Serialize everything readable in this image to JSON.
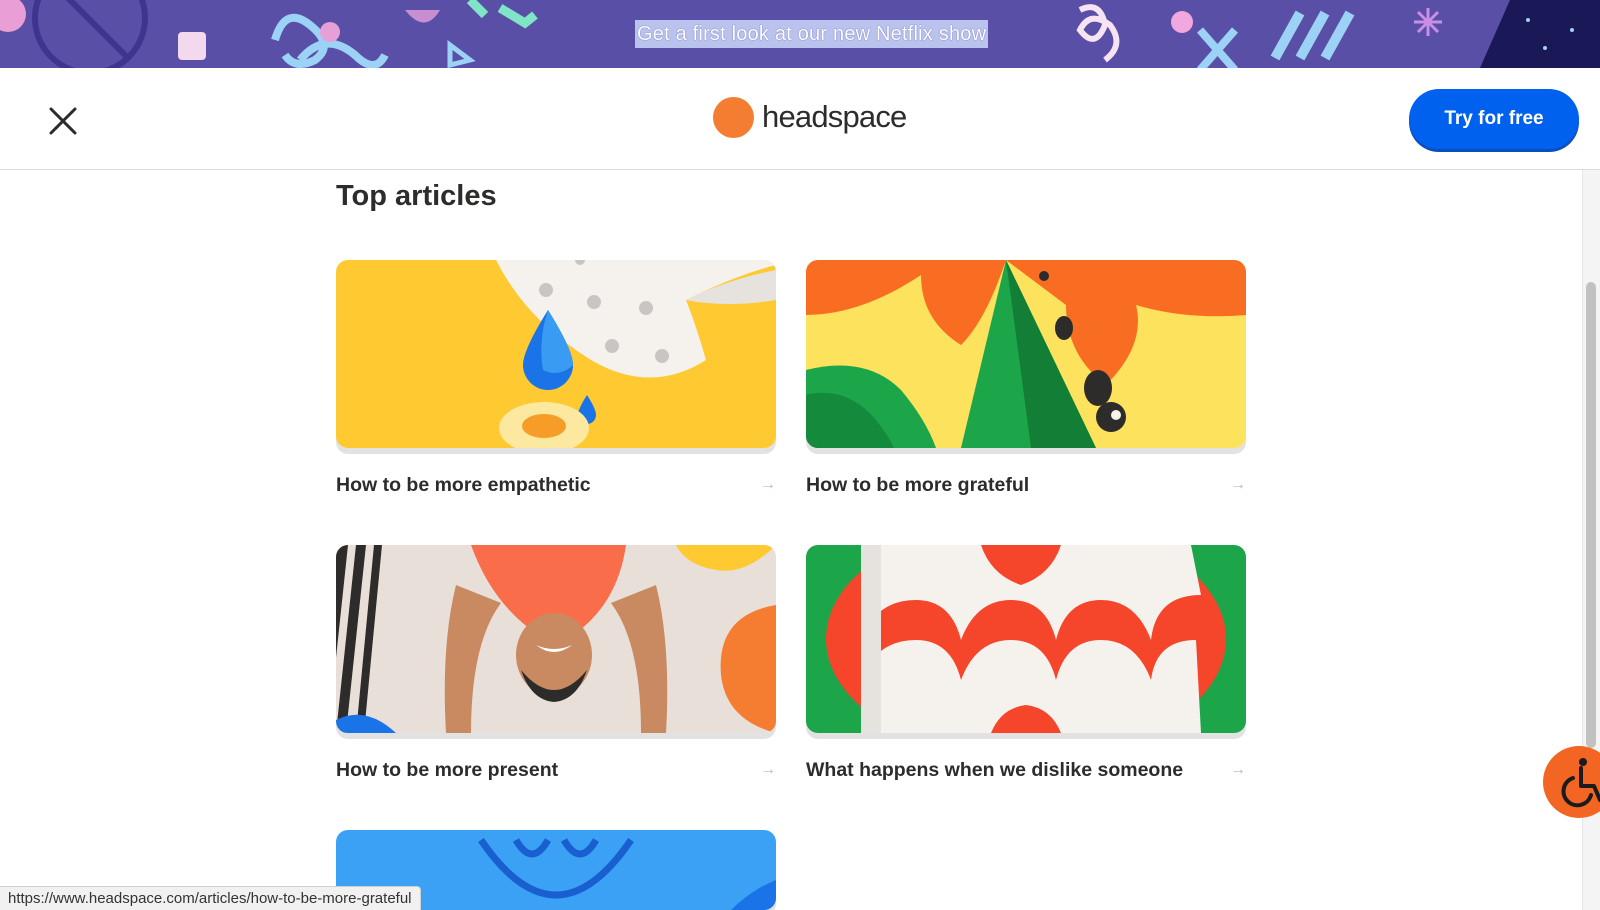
{
  "banner": {
    "link_text": "Get a first look at our new Netflix show"
  },
  "header": {
    "logo_text": "headspace",
    "cta_label": "Try for free",
    "close_icon": "close-icon"
  },
  "colors": {
    "banner_bg": "#5a4fa6",
    "cta_bg": "#0061ef",
    "logo_orange": "#f47d31",
    "a11y_orange": "#f26522"
  },
  "section": {
    "title": "Top articles"
  },
  "articles": [
    {
      "title": "How to be more empathetic",
      "arrow": "→"
    },
    {
      "title": "How to be more grateful",
      "arrow": "→"
    },
    {
      "title": "How to be more present",
      "arrow": "→"
    },
    {
      "title": "What happens when we dislike someone",
      "arrow": "→"
    }
  ],
  "accessibility": {
    "icon": "wheelchair-icon"
  },
  "status_bar": {
    "url": "https://www.headspace.com/articles/how-to-be-more-grateful"
  }
}
